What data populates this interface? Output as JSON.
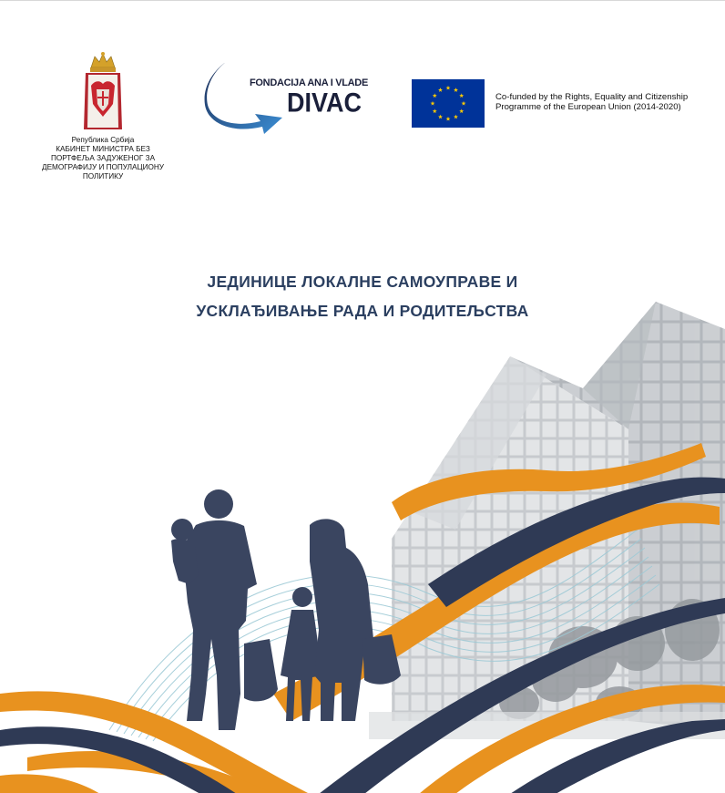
{
  "header": {
    "serbia": {
      "lines": [
        "Република Србија",
        "КАБИНЕТ МИНИСТРА БЕЗ",
        "ПОРТФЕЉА ЗАДУЖЕНОГ ЗА",
        "ДЕМОГРАФИЈУ И ПОПУЛАЦИОНУ",
        "ПОЛИТИКУ"
      ],
      "icon": "serbian-coat-of-arms-icon"
    },
    "divac": {
      "small_text": "FONDACIJA ANA I VLADE",
      "big_text": "DIVAC",
      "icon": "swoosh-arrow-icon"
    },
    "eu": {
      "lines": [
        "Co-funded by the Rights, Equality and Citizenship",
        "Programme of the European Union (2014-2020)"
      ],
      "icon": "eu-flag-icon",
      "flag_color": "#003399",
      "star_color": "#ffcc00"
    }
  },
  "title": {
    "line1": "ЈЕДИНИЦЕ ЛОКАЛНЕ САМОУПРАВЕ И",
    "line2": "УСКЛАЂИВАЊЕ РАДА И РОДИТЕЉСТВА"
  },
  "colors": {
    "title": "#2b3f60",
    "navy": "#2f3a55",
    "orange": "#e8921f",
    "silhouette": "#3a4560",
    "building": "#9aa0a6"
  }
}
